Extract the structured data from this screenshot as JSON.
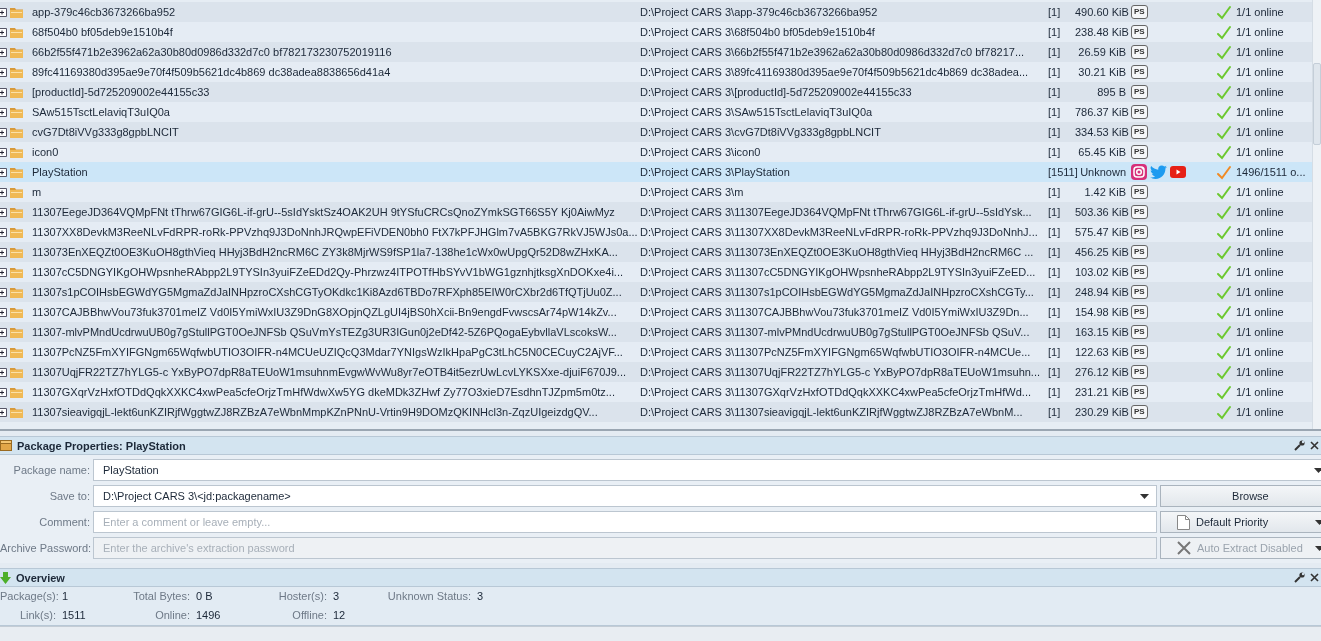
{
  "packages": {
    "rows": [
      {
        "name": "app-379c46cb3673266ba952",
        "path": "D:\\Project CARS 3\\app-379c46cb3673266ba952",
        "count": "[1]",
        "size": "490.60 KiB",
        "hosters": [
          {
            "kind": "badge",
            "text": "PS"
          }
        ],
        "status": "1/1 online",
        "complete": true,
        "selected": false
      },
      {
        "name": "68f504b0 bf05deb9e1510b4f",
        "path": "D:\\Project CARS 3\\68f504b0 bf05deb9e1510b4f",
        "count": "[1]",
        "size": "238.48 KiB",
        "hosters": [
          {
            "kind": "badge",
            "text": "PS"
          }
        ],
        "status": "1/1 online",
        "complete": true,
        "selected": false
      },
      {
        "name": "66b2f55f471b2e3962a62a30b80d0986d332d7c0 bf782173230752019116",
        "path": "D:\\Project CARS 3\\66b2f55f471b2e3962a62a30b80d0986d332d7c0 bf78217...",
        "count": "[1]",
        "size": "26.59 KiB",
        "hosters": [
          {
            "kind": "badge",
            "text": "PS"
          }
        ],
        "status": "1/1 online",
        "complete": true,
        "selected": false
      },
      {
        "name": "89fc41169380d395ae9e70f4f509b5621dc4b869 dc38adea8838656d41a4",
        "path": "D:\\Project CARS 3\\89fc41169380d395ae9e70f4f509b5621dc4b869 dc38adea...",
        "count": "[1]",
        "size": "30.21 KiB",
        "hosters": [
          {
            "kind": "badge",
            "text": "PS"
          }
        ],
        "status": "1/1 online",
        "complete": true,
        "selected": false
      },
      {
        "name": "[productId]-5d725209002e44155c33",
        "path": "D:\\Project CARS 3\\[productId]-5d725209002e44155c33",
        "count": "[1]",
        "size": "895 B",
        "hosters": [
          {
            "kind": "badge",
            "text": "PS"
          }
        ],
        "status": "1/1 online",
        "complete": true,
        "selected": false
      },
      {
        "name": "SAw515TsctLelaviqT3uIQ0a",
        "path": "D:\\Project CARS 3\\SAw515TsctLelaviqT3uIQ0a",
        "count": "[1]",
        "size": "786.37 KiB",
        "hosters": [
          {
            "kind": "badge",
            "text": "PS"
          }
        ],
        "status": "1/1 online",
        "complete": true,
        "selected": false
      },
      {
        "name": "cvG7Dt8iVVg333g8gpbLNCIT",
        "path": "D:\\Project CARS 3\\cvG7Dt8iVVg333g8gpbLNCIT",
        "count": "[1]",
        "size": "334.53 KiB",
        "hosters": [
          {
            "kind": "badge",
            "text": "PS"
          }
        ],
        "status": "1/1 online",
        "complete": true,
        "selected": false
      },
      {
        "name": "icon0",
        "path": "D:\\Project CARS 3\\icon0",
        "count": "[1]",
        "size": "65.45 KiB",
        "hosters": [
          {
            "kind": "badge",
            "text": "PS"
          }
        ],
        "status": "1/1 online",
        "complete": true,
        "selected": false
      },
      {
        "name": "PlayStation",
        "path": "D:\\Project CARS 3\\PlayStation",
        "count": "[1511]",
        "size": "Unknown",
        "hosters": [
          {
            "kind": "instagram"
          },
          {
            "kind": "twitter"
          },
          {
            "kind": "youtube"
          }
        ],
        "status": "1496/1511 o...",
        "complete": false,
        "selected": true
      },
      {
        "name": "m",
        "path": "D:\\Project CARS 3\\m",
        "count": "[1]",
        "size": "1.42 KiB",
        "hosters": [
          {
            "kind": "badge",
            "text": "PS"
          }
        ],
        "status": "1/1 online",
        "complete": true,
        "selected": false
      },
      {
        "name": "11307EegeJD364VQMpFNt tThrw67GIG6L-if-grU--5sIdYsktSz4OAK2UH 9tYSfuCRCsQnoZYmkSGT66S5Y Kj0AiwMyz",
        "path": "D:\\Project CARS 3\\11307EegeJD364VQMpFNt tThrw67GIG6L-if-grU--5sIdYsk...",
        "count": "[1]",
        "size": "503.36 KiB",
        "hosters": [
          {
            "kind": "badge",
            "text": "PS"
          }
        ],
        "status": "1/1 online",
        "complete": true,
        "selected": false
      },
      {
        "name": "11307XX8DevkM3ReeNLvFdRPR-roRk-PPVzhq9J3DoNnhJRQwpEFiVDEN0bh0 FtX7kPFJHGlm7vA5BKG7RkVJ5WJs0a...",
        "path": "D:\\Project CARS 3\\11307XX8DevkM3ReeNLvFdRPR-roRk-PPVzhq9J3DoNnhJ...",
        "count": "[1]",
        "size": "575.47 KiB",
        "hosters": [
          {
            "kind": "badge",
            "text": "PS"
          }
        ],
        "status": "1/1 online",
        "complete": true,
        "selected": false
      },
      {
        "name": "113073EnXEQZt0OE3KuOH8gthVieq HHyj3BdH2ncRM6C ZY3k8MjrWS9fSP1la7-138he1cWx0wUpgQr52D8wZHxKA...",
        "path": "D:\\Project CARS 3\\113073EnXEQZt0OE3KuOH8gthVieq HHyj3BdH2ncRM6C ...",
        "count": "[1]",
        "size": "456.25 KiB",
        "hosters": [
          {
            "kind": "badge",
            "text": "PS"
          }
        ],
        "status": "1/1 online",
        "complete": true,
        "selected": false
      },
      {
        "name": "11307cC5DNGYIKgOHWpsnheRAbpp2L9TYSIn3yuiFZeEDd2Qy-Phrzwz4ITPOTfHbSYvV1bWG1gznhjtksgXnDOKxe4i...",
        "path": "D:\\Project CARS 3\\11307cC5DNGYIKgOHWpsnheRAbpp2L9TYSIn3yuiFZeED...",
        "count": "[1]",
        "size": "103.02 KiB",
        "hosters": [
          {
            "kind": "badge",
            "text": "PS"
          }
        ],
        "status": "1/1 online",
        "complete": true,
        "selected": false
      },
      {
        "name": "11307s1pCOIHsbEGWdYG5MgmaZdJaINHpzroCXshCGTyOKdkc1Ki8Azd6TBDo7RFXph85EIW0rCXbr2d6TfQTjUu0Z...",
        "path": "D:\\Project CARS 3\\11307s1pCOIHsbEGWdYG5MgmaZdJaINHpzroCXshCGTy...",
        "count": "[1]",
        "size": "248.94 KiB",
        "hosters": [
          {
            "kind": "badge",
            "text": "PS"
          }
        ],
        "status": "1/1 online",
        "complete": true,
        "selected": false
      },
      {
        "name": "11307CAJBBhwVou73fuk3701meIZ Vd0I5YmiWxIU3Z9DnG8XOpjnQZLgUI4jBS0hXcii-Bn9engdFvwscsAr74pW14kZv...",
        "path": "D:\\Project CARS 3\\11307CAJBBhwVou73fuk3701meIZ Vd0I5YmiWxIU3Z9Dn...",
        "count": "[1]",
        "size": "154.98 KiB",
        "hosters": [
          {
            "kind": "badge",
            "text": "PS"
          }
        ],
        "status": "1/1 online",
        "complete": true,
        "selected": false
      },
      {
        "name": "11307-mlvPMndUcdrwuUB0g7gStullPGT0OeJNFSb QSuVmYsTEZg3UR3IGun0j2eDf42-5Z6PQogaEybvllaVLscoksW...",
        "path": "D:\\Project CARS 3\\11307-mlvPMndUcdrwuUB0g7gStullPGT0OeJNFSb QSuV...",
        "count": "[1]",
        "size": "163.15 KiB",
        "hosters": [
          {
            "kind": "badge",
            "text": "PS"
          }
        ],
        "status": "1/1 online",
        "complete": true,
        "selected": false
      },
      {
        "name": "11307PcNZ5FmXYIFGNgm65WqfwbUTIO3OIFR-n4MCUeUZIQcQ3Mdar7YNIgsWzIkHpaPgC3tLhC5N0CECuyC2AjVF...",
        "path": "D:\\Project CARS 3\\11307PcNZ5FmXYIFGNgm65WqfwbUTIO3OIFR-n4MCUe...",
        "count": "[1]",
        "size": "122.63 KiB",
        "hosters": [
          {
            "kind": "badge",
            "text": "PS"
          }
        ],
        "status": "1/1 online",
        "complete": true,
        "selected": false
      },
      {
        "name": "11307UqjFR22TZ7hYLG5-c YxByPO7dpR8aTEUoW1msuhnmEvgwWvWu8yr7eOTB4it5ezrUwLcvLYKSXxe-djuiF670J9...",
        "path": "D:\\Project CARS 3\\11307UqjFR22TZ7hYLG5-c YxByPO7dpR8aTEUoW1msuhn...",
        "count": "[1]",
        "size": "276.12 KiB",
        "hosters": [
          {
            "kind": "badge",
            "text": "PS"
          }
        ],
        "status": "1/1 online",
        "complete": true,
        "selected": false
      },
      {
        "name": "11307GXqrVzHxfOTDdQqkXXKC4xwPea5cfeOrjzTmHfWdwXw5YG dkeMDk3ZHwf Zy77O3xieD7EsdhnTJZpm5m0tz...",
        "path": "D:\\Project CARS 3\\11307GXqrVzHxfOTDdQqkXXKC4xwPea5cfeOrjzTmHfWd...",
        "count": "[1]",
        "size": "231.21 KiB",
        "hosters": [
          {
            "kind": "badge",
            "text": "PS"
          }
        ],
        "status": "1/1 online",
        "complete": true,
        "selected": false
      },
      {
        "name": "11307sieavigqjL-lekt6unKZIRjfWggtwZJ8RZBzA7eWbnMmpKZnPNnU-Vrtin9H9DOMzQKINHcl3n-ZqzUIgeizdgQV...",
        "path": "D:\\Project CARS 3\\11307sieavigqjL-lekt6unKZIRjfWggtwZJ8RZBzA7eWbnM...",
        "count": "[1]",
        "size": "230.29 KiB",
        "hosters": [
          {
            "kind": "badge",
            "text": "PS"
          }
        ],
        "status": "1/1 online",
        "complete": true,
        "selected": false
      }
    ]
  },
  "properties": {
    "title": "Package Properties: PlayStation",
    "rows": [
      {
        "label": "Package name:",
        "field": {
          "kind": "dropdown",
          "value": "PlayStation"
        }
      },
      {
        "label": "Save to:",
        "field": {
          "kind": "dropdown",
          "value": "D:\\Project CARS 3\\<jd:packagename>"
        },
        "side": {
          "kind": "button",
          "label": "Browse",
          "disabled": false
        }
      },
      {
        "label": "Comment:",
        "field": {
          "kind": "input",
          "placeholder": "Enter a comment or leave empty...",
          "disabled": false
        },
        "side": {
          "kind": "priority",
          "label": "Default Priority",
          "disabled": false
        }
      },
      {
        "label": "Archive Password:",
        "field": {
          "kind": "input",
          "placeholder": "Enter the archive's extraction password",
          "disabled": true
        },
        "side": {
          "kind": "extract",
          "label": "Auto Extract Disabled",
          "disabled": true
        }
      }
    ]
  },
  "overview": {
    "title": "Overview",
    "stats": [
      [
        {
          "label": "Package(s):",
          "value": "1"
        },
        {
          "label": "Total Bytes:",
          "value": "0 B"
        },
        {
          "label": "Hoster(s):",
          "value": "3"
        },
        {
          "label": "Unknown Status:",
          "value": "3"
        }
      ],
      [
        {
          "label": "Link(s):",
          "value": "1511"
        },
        {
          "label": "Online:",
          "value": "1496"
        },
        {
          "label": "Offline:",
          "value": "12"
        }
      ]
    ]
  }
}
